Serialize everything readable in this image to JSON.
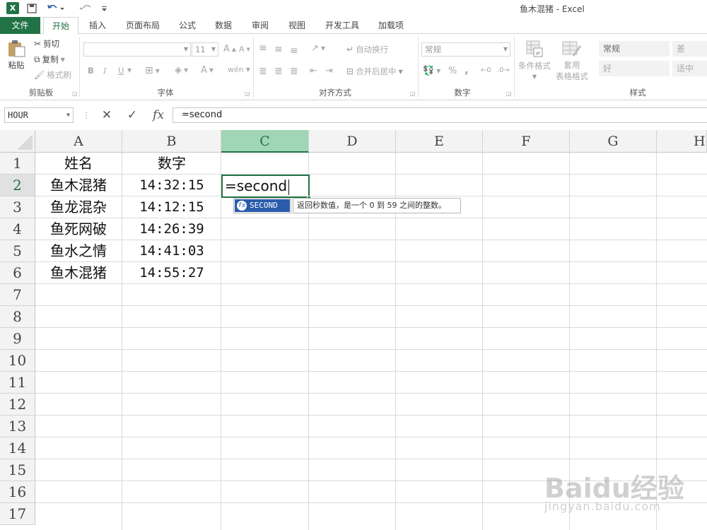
{
  "window": {
    "title": "鱼木混猪 - Excel",
    "app_icon": "X"
  },
  "ribbon_tabs": [
    "文件",
    "开始",
    "插入",
    "页面布局",
    "公式",
    "数据",
    "审阅",
    "视图",
    "开发工具",
    "加载项"
  ],
  "ribbon": {
    "clipboard": {
      "paste": "粘贴",
      "cut": "剪切",
      "copy": "复制",
      "format_painter": "格式刷",
      "label": "剪贴板"
    },
    "font": {
      "size": "11",
      "bold": "B",
      "italic": "I",
      "underline": "U",
      "label": "字体"
    },
    "alignment": {
      "wrap_text": "自动换行",
      "merge_center": "合并后居中",
      "label": "对齐方式"
    },
    "number": {
      "format": "常规",
      "percent": "%",
      "comma": ",",
      "label": "数字"
    },
    "styles": {
      "conditional": "条件格式",
      "table_format_1": "套用",
      "table_format_2": "表格格式",
      "normal": "常规",
      "bad": "差",
      "good": "好",
      "neutral": "适中",
      "label": "样式"
    }
  },
  "formula_bar": {
    "name_box": "HOUR",
    "formula": "=second",
    "fx": "fx"
  },
  "grid": {
    "columns": [
      "A",
      "B",
      "C",
      "D",
      "E",
      "F",
      "G",
      "H"
    ],
    "rows": [
      "1",
      "2",
      "3",
      "4",
      "5",
      "6",
      "7",
      "8",
      "9",
      "10",
      "11",
      "12",
      "13",
      "14",
      "15",
      "16",
      "17"
    ],
    "data": [
      [
        "姓名",
        "数字"
      ],
      [
        "鱼木混猪",
        "14:32:15"
      ],
      [
        "鱼龙混杂",
        "14:12:15"
      ],
      [
        "鱼死网破",
        "14:26:39"
      ],
      [
        "鱼水之情",
        "14:41:03"
      ],
      [
        "鱼木混猪",
        "14:55:27"
      ]
    ],
    "active_cell_text": "=second"
  },
  "autocomplete": {
    "function": "SECOND",
    "tooltip": "返回秒数值，是一个 0 到 59 之间的整数。"
  },
  "watermark": {
    "main": "Baidu经验",
    "sub": "jingyan.baidu.com"
  }
}
